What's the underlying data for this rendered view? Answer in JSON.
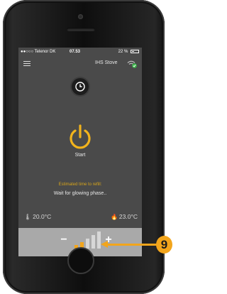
{
  "status_bar": {
    "carrier": "●●○○○ Telenor DK",
    "time": "07.53",
    "battery": "22 %"
  },
  "header": {
    "device_name": "IHS Stove"
  },
  "main": {
    "start_label": "Start",
    "refill_label": "Estimated time to refill:",
    "phase_text": "Wait for glowing phase..",
    "temp_current": "20.0°C",
    "temp_target": "23.0°C"
  },
  "controls": {
    "minus_label": "−",
    "plus_label": "+",
    "level_bars": [
      {
        "active": true
      },
      {
        "active": true
      },
      {
        "active": false
      },
      {
        "active": false
      },
      {
        "active": false
      }
    ]
  },
  "callout": {
    "number": "9"
  },
  "colors": {
    "accent": "#F2A51C",
    "screen_bg": "#4A4A4A",
    "control_bg": "#A9A9A9",
    "connected": "#3CB44A"
  },
  "icons": {
    "menu": "hamburger-icon",
    "wifi": "wifi-icon",
    "clock": "clock-icon",
    "power": "power-icon",
    "thermometer": "thermometer-icon",
    "target_temp": "flame-icon"
  }
}
